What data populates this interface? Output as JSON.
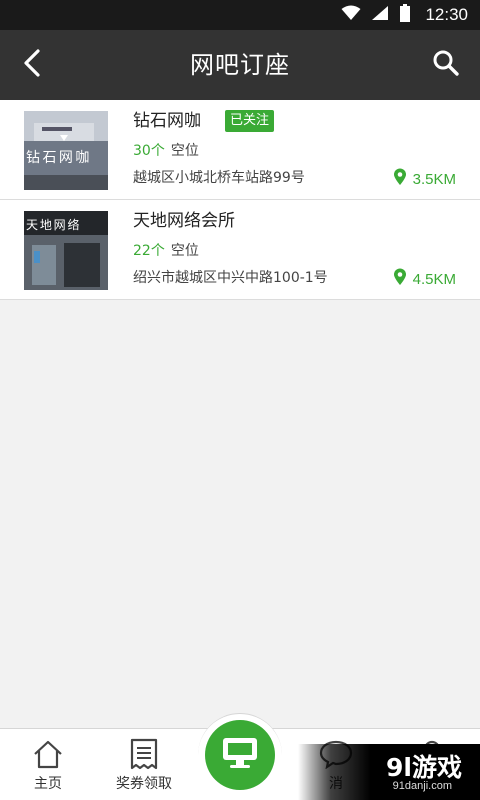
{
  "status_bar": {
    "time": "12:30"
  },
  "nav": {
    "title": "网吧订座"
  },
  "cafes": [
    {
      "name": "钻石网咖",
      "badge": "已关注",
      "seats_count": "30个",
      "seats_label": "空位",
      "address": "越城区小城北桥车站路99号",
      "distance": "3.5KM",
      "thumb_sign": "钻 石 网 咖"
    },
    {
      "name": "天地网络会所",
      "badge": "",
      "seats_count": "22个",
      "seats_label": "空位",
      "address": "绍兴市越城区中兴中路100-1号",
      "distance": "4.5KM",
      "thumb_sign": "天 地 网 络"
    }
  ],
  "tabs": {
    "home": "主页",
    "coupons": "奖券领取",
    "messages": "消"
  },
  "watermark": {
    "main": "9l游戏",
    "sub": "91danji.com"
  },
  "colors": {
    "accent": "#3aaa35",
    "nav_bg": "#333333",
    "status_bg": "#1a1a1a",
    "page_bg": "#f2f2f2"
  },
  "icons": {
    "status": [
      "wifi-icon",
      "signal-icon",
      "battery-icon"
    ],
    "nav": [
      "back-arrow-icon",
      "search-icon"
    ],
    "tabs": [
      "home-icon",
      "receipt-icon",
      "computer-monitor-icon",
      "chat-bubble-icon"
    ],
    "distance": "location-pin-icon"
  }
}
